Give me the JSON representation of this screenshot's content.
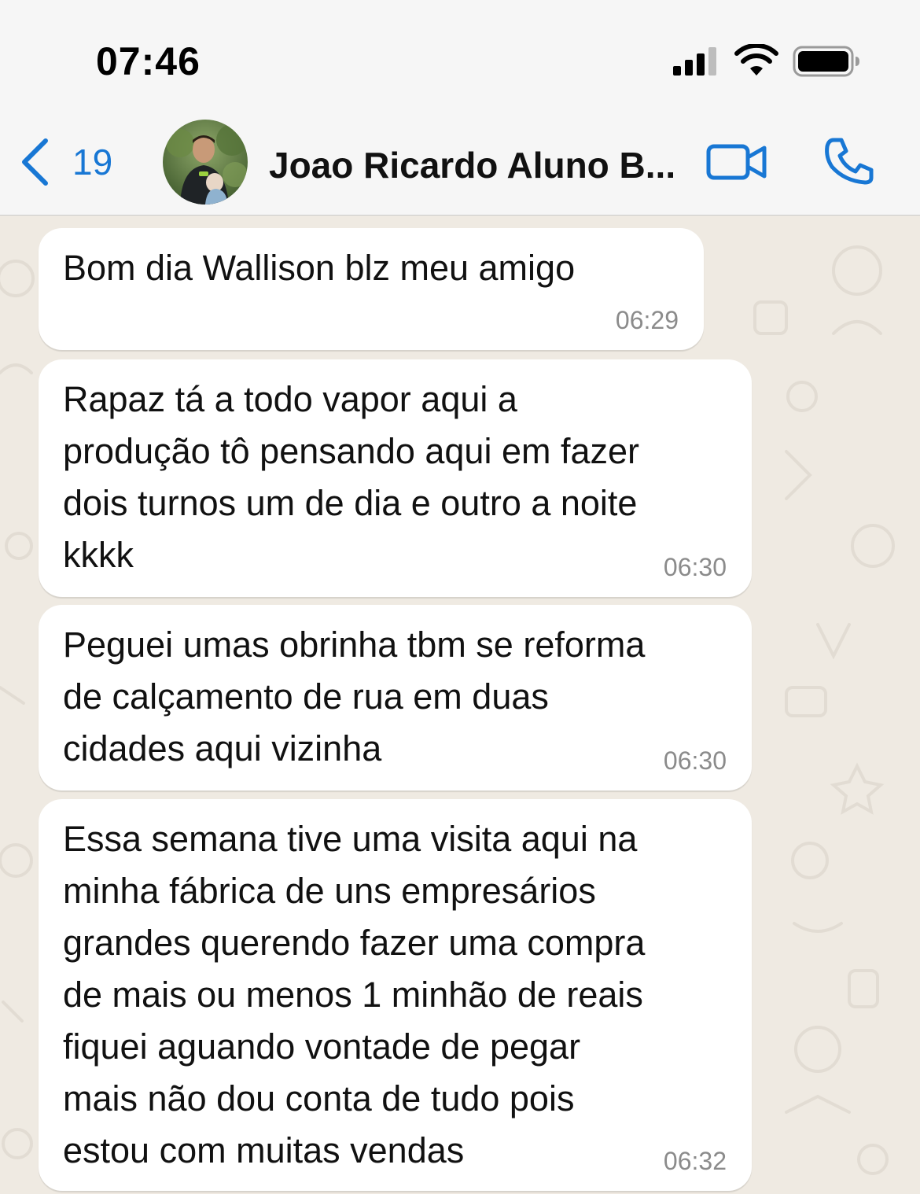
{
  "status_bar": {
    "time": "07:46",
    "signal_icon": "cellular-signal-icon",
    "wifi_icon": "wifi-icon",
    "battery_icon": "battery-icon"
  },
  "header": {
    "back_icon": "chevron-left-icon",
    "back_count": "19",
    "contact_name": "Joao Ricardo Aluno B...",
    "video_icon": "video-camera-icon",
    "phone_icon": "phone-icon",
    "accent_color": "#1877d4"
  },
  "messages": [
    {
      "text": "Bom dia Wallison blz meu amigo",
      "time": "06:29"
    },
    {
      "text": "Rapaz tá a todo vapor aqui a\nprodução tô pensando aqui em fazer\ndois turnos um de dia e outro a noite\nkkkk",
      "time": "06:30"
    },
    {
      "text": "Peguei umas obrinha tbm se reforma\nde calçamento de rua em duas\ncidades aqui vizinha",
      "time": "06:30"
    },
    {
      "text": "Essa semana tive uma visita aqui na\nminha fábrica de uns empresários\ngrandes querendo fazer uma compra\nde mais ou menos 1 minhão de reais\nfiquei aguando vontade de pegar\nmais não dou conta de tudo pois\nestou com muitas vendas",
      "time": "06:32"
    }
  ]
}
